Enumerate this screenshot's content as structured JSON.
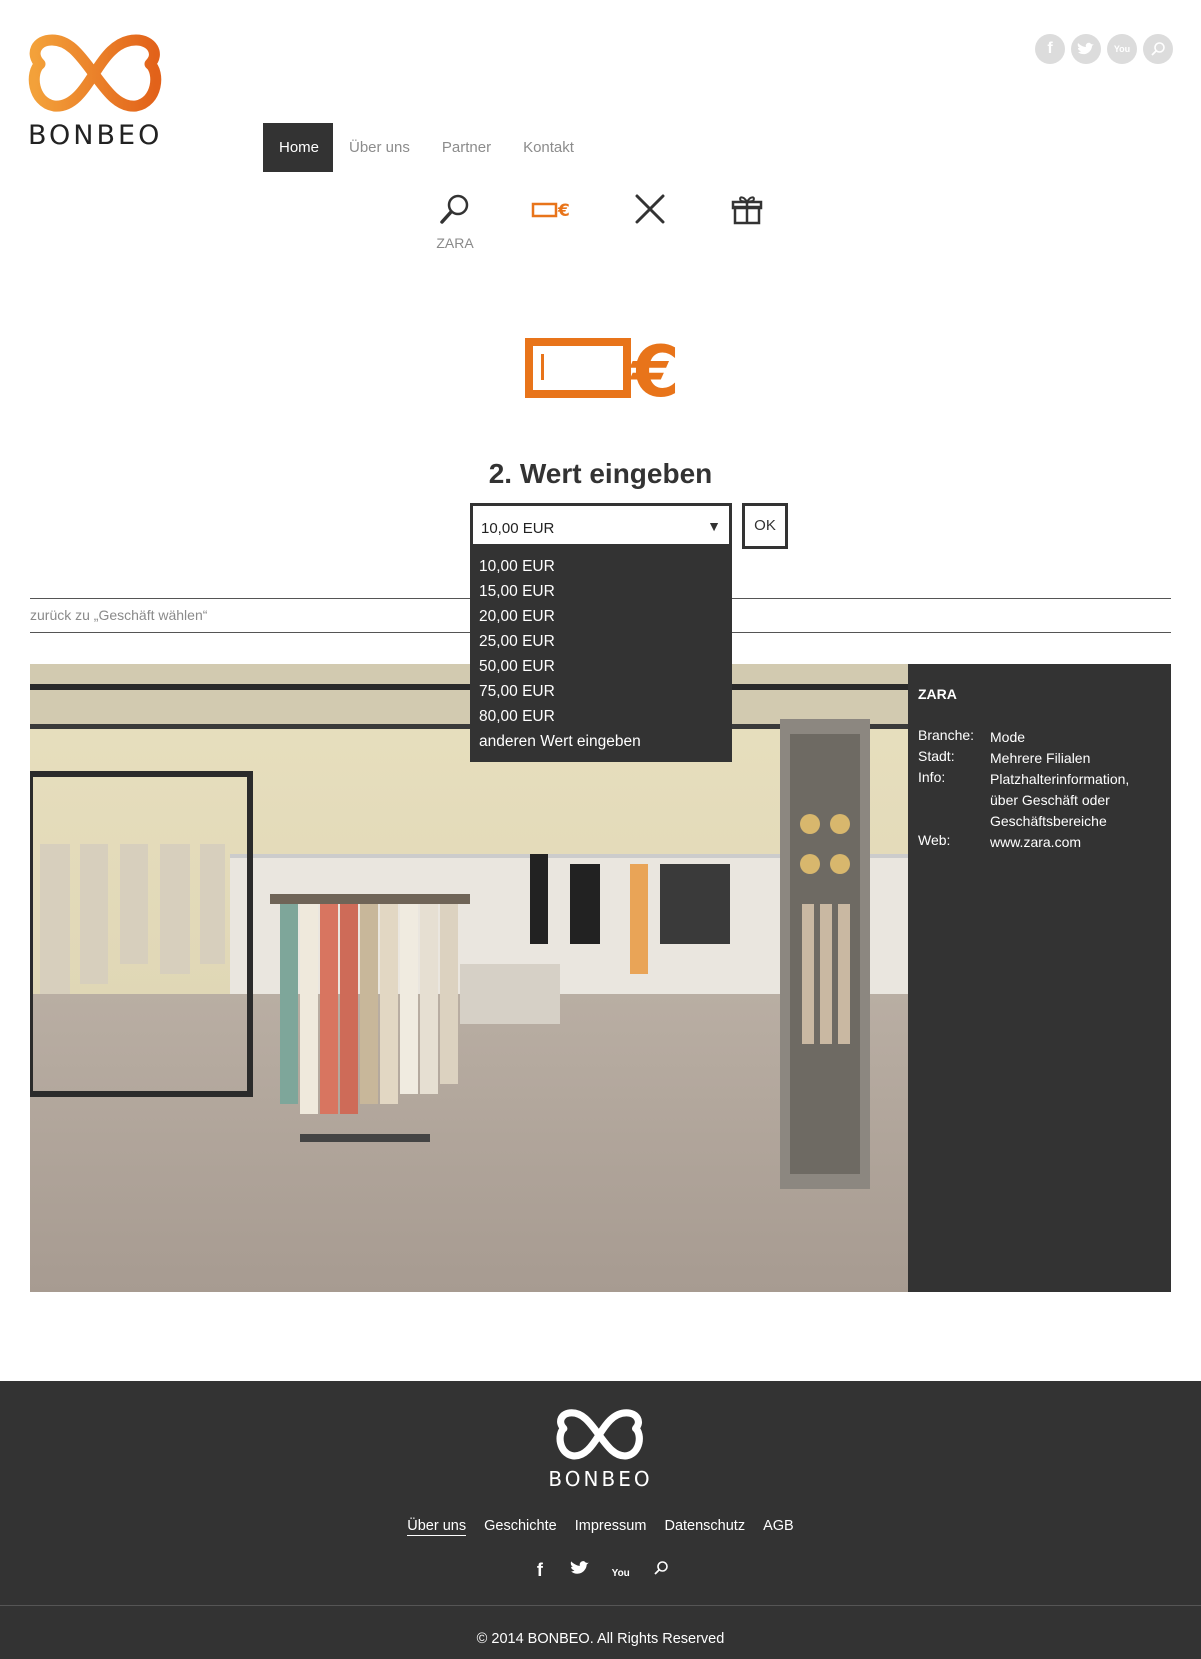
{
  "brand": {
    "name": "BONBEO",
    "color": "#E8741A"
  },
  "social_top": [
    {
      "icon": "facebook-icon",
      "glyph": "f"
    },
    {
      "icon": "twitter-icon",
      "glyph": "t"
    },
    {
      "icon": "youtube-icon",
      "glyph": "You"
    },
    {
      "icon": "search-icon",
      "glyph": "⚲"
    }
  ],
  "nav": {
    "items": [
      {
        "label": "Home",
        "active": true
      },
      {
        "label": "Über uns"
      },
      {
        "label": "Partner"
      },
      {
        "label": "Kontakt"
      }
    ]
  },
  "steps": [
    {
      "icon": "search-icon",
      "label": "ZARA"
    },
    {
      "icon": "voucher-euro-icon",
      "label": ""
    },
    {
      "icon": "pen-brush-icon",
      "label": ""
    },
    {
      "icon": "gift-icon",
      "label": ""
    }
  ],
  "step_title": "2. Wert eingeben",
  "value_select": {
    "selected": "10,00 EUR",
    "options": [
      "10,00 EUR",
      "15,00 EUR",
      "20,00 EUR",
      "25,00 EUR",
      "50,00 EUR",
      "75,00 EUR",
      "80,00 EUR",
      "anderen Wert eingeben"
    ]
  },
  "ok_label": "OK",
  "back_link": "zurück zu „Geschäft wählen“",
  "store": {
    "name": "ZARA",
    "rows": [
      {
        "key": "Branche:",
        "value": "Mode"
      },
      {
        "key": "Stadt:",
        "value": "Mehrere Filialen"
      },
      {
        "key": "Info:",
        "value": "Platzhalterinformation, über Geschäft oder Geschäftsbereiche"
      },
      {
        "key": "Web:",
        "value": "www.zara.com"
      }
    ]
  },
  "footer": {
    "brand": "BONBEO",
    "links": [
      "Über uns",
      "Geschichte",
      "Impressum",
      "Datenschutz",
      "AGB"
    ],
    "social": [
      {
        "icon": "facebook-icon",
        "glyph": "f"
      },
      {
        "icon": "twitter-icon",
        "glyph": "t"
      },
      {
        "icon": "youtube-icon",
        "glyph": "You"
      },
      {
        "icon": "search-icon",
        "glyph": "⚲"
      }
    ],
    "copyright": "© 2014 BONBEO. All Rights Reserved"
  }
}
